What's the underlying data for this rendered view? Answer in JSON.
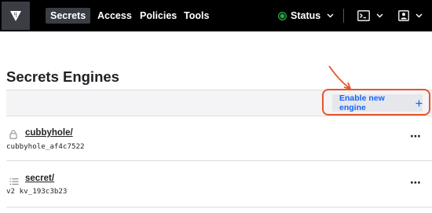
{
  "nav": {
    "items": [
      {
        "label": "Secrets",
        "active": true
      },
      {
        "label": "Access",
        "active": false
      },
      {
        "label": "Policies",
        "active": false
      },
      {
        "label": "Tools",
        "active": false
      }
    ],
    "status_label": "Status",
    "status_color": "#2ca845",
    "console_icon": "terminal-icon",
    "user_icon": "user-icon"
  },
  "page": {
    "title": "Secrets Engines",
    "enable_button_label": "Enable new engine",
    "enable_button_icon": "plus-icon",
    "annotation_color": "#e8542b"
  },
  "engines": [
    {
      "name": "cubbyhole/",
      "meta": "cubbyhole_af4c7522",
      "icon": "lock-icon"
    },
    {
      "name": "secret/",
      "meta": "v2 kv_193c3b23",
      "icon": "list-icon"
    }
  ]
}
